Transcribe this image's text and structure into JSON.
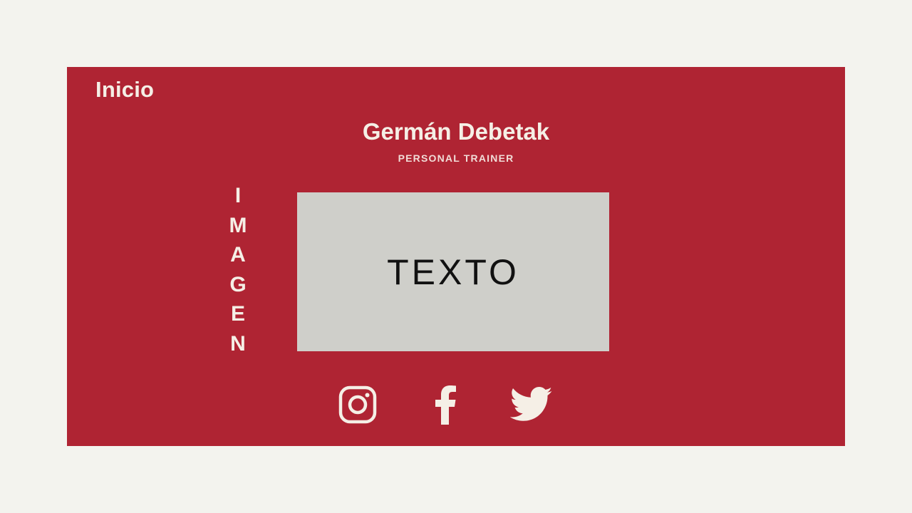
{
  "nav": {
    "home_label": "Inicio"
  },
  "profile": {
    "name": "Germán Debetak",
    "role": "PERSONAL TRAINER"
  },
  "image_placeholder": {
    "label": [
      "I",
      "M",
      "A",
      "G",
      "E",
      "N"
    ]
  },
  "text_placeholder": {
    "label": "TEXTO"
  },
  "social_links": [
    {
      "icon": "instagram-icon"
    },
    {
      "icon": "facebook-icon"
    },
    {
      "icon": "twitter-icon"
    }
  ],
  "colors": {
    "page_background": "#f3f3ee",
    "card_background": "#af2433",
    "text_light": "#f5efe6",
    "placeholder_box": "#cfcfca"
  }
}
